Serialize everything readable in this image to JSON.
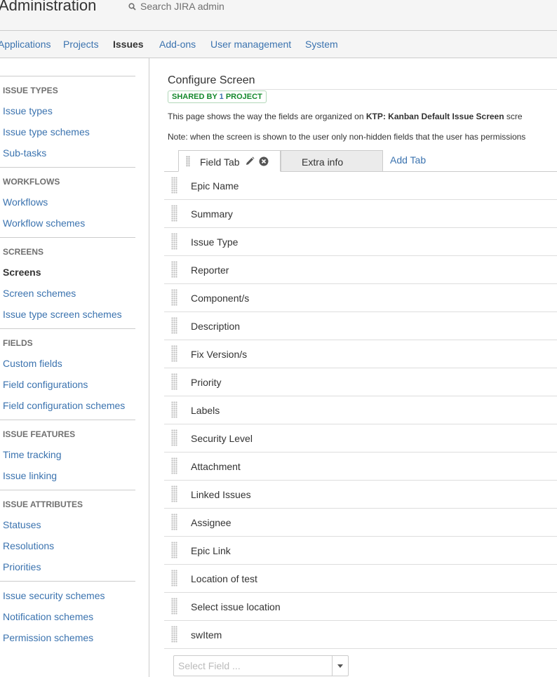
{
  "header": {
    "title": "Administration",
    "search_placeholder": "Search JIRA admin"
  },
  "nav": {
    "items": [
      {
        "label": "Applications"
      },
      {
        "label": "Projects"
      },
      {
        "label": "Issues"
      },
      {
        "label": "Add-ons"
      },
      {
        "label": "User management"
      },
      {
        "label": "System"
      }
    ],
    "active": "Issues"
  },
  "sidebar": {
    "sections": [
      {
        "heading": "ISSUE TYPES",
        "items": [
          "Issue types",
          "Issue type schemes",
          "Sub-tasks"
        ]
      },
      {
        "heading": "WORKFLOWS",
        "items": [
          "Workflows",
          "Workflow schemes"
        ]
      },
      {
        "heading": "SCREENS",
        "items": [
          "Screens",
          "Screen schemes",
          "Issue type screen schemes"
        ]
      },
      {
        "heading": "FIELDS",
        "items": [
          "Custom fields",
          "Field configurations",
          "Field configuration schemes"
        ]
      },
      {
        "heading": "ISSUE FEATURES",
        "items": [
          "Time tracking",
          "Issue linking"
        ]
      },
      {
        "heading": "ISSUE ATTRIBUTES",
        "items": [
          "Statuses",
          "Resolutions",
          "Priorities"
        ]
      },
      {
        "heading": "",
        "items": [
          "Issue security schemes",
          "Notification schemes",
          "Permission schemes"
        ]
      }
    ],
    "active_item": "Screens"
  },
  "main": {
    "title": "Configure Screen",
    "badge_prefix": "SHARED BY ",
    "badge_count": "1",
    "badge_suffix": " PROJECT",
    "desc1_prefix": "This page shows the way the fields are organized on ",
    "desc1_screen": "KTP: Kanban Default Issue Screen",
    "desc1_suffix": " scre",
    "desc2": "Note: when the screen is shown to the user only non-hidden fields that the user has permissions",
    "tabs": [
      {
        "label": "Field Tab",
        "active": true
      },
      {
        "label": "Extra info",
        "active": false
      }
    ],
    "add_tab": "Add Tab",
    "fields": [
      "Epic Name",
      "Summary",
      "Issue Type",
      "Reporter",
      "Component/s",
      "Description",
      "Fix Version/s",
      "Priority",
      "Labels",
      "Security Level",
      "Attachment",
      "Linked Issues",
      "Assignee",
      "Epic Link",
      "Location of test",
      "Select issue location",
      "swItem"
    ],
    "select_field_placeholder": "Select Field ..."
  },
  "colors": {
    "link": "#3b73af",
    "success": "#14892c",
    "bar_bg": "#f5f5f5"
  }
}
